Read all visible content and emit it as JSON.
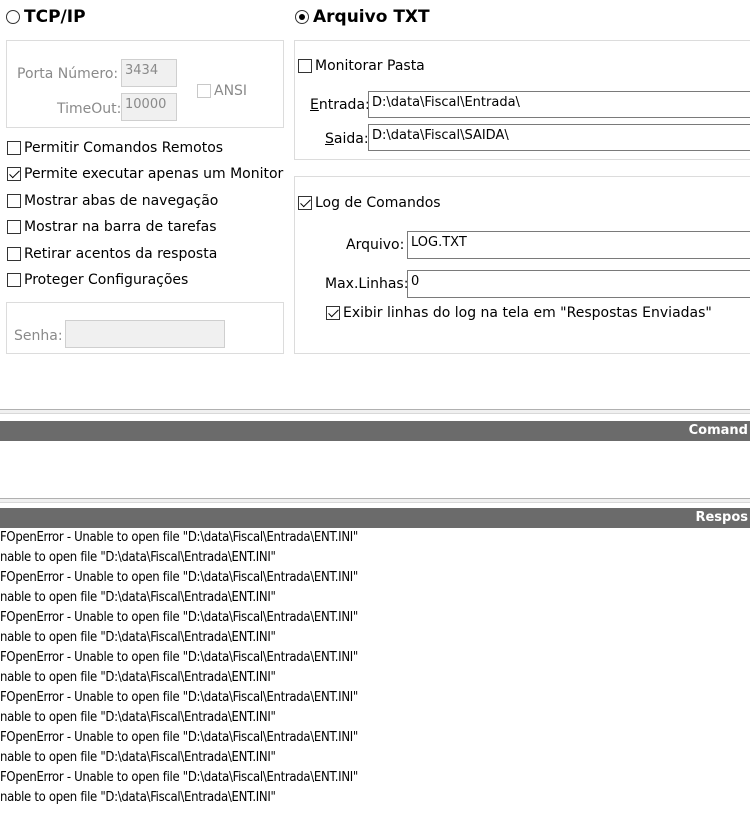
{
  "tcp": {
    "radio_label": "TCP/IP",
    "porta_label": "Porta Número:",
    "porta_value": "3434",
    "timeout_label": "TimeOut:",
    "timeout_value": "10000",
    "ansi_label": "ANSI"
  },
  "options": [
    {
      "label": "Permitir Comandos Remotos",
      "checked": false
    },
    {
      "label": "Permite executar apenas um Monitor",
      "checked": true
    },
    {
      "label": "Mostrar abas de navegação",
      "checked": false
    },
    {
      "label": "Mostrar na barra de tarefas",
      "checked": false
    },
    {
      "label": "Retirar acentos da resposta",
      "checked": false
    },
    {
      "label": "Proteger Configurações",
      "checked": false
    }
  ],
  "senha": {
    "label": "Senha:",
    "value": ""
  },
  "txt": {
    "radio_label": "Arquivo TXT",
    "monitorar_label": "Monitorar Pasta",
    "entrada_label": "Entrada:",
    "entrada_value": "D:\\data\\Fiscal\\Entrada\\",
    "saida_label": "Saida:",
    "saida_value": "D:\\data\\Fiscal\\SAIDA\\"
  },
  "log": {
    "log_label": "Log de Comandos",
    "arquivo_label": "Arquivo:",
    "arquivo_value": "LOG.TXT",
    "maxlinhas_label": "Max.Linhas:",
    "maxlinhas_value": "0",
    "exibir_label": "Exibir linhas do log na tela em \"Respostas Enviadas\""
  },
  "comandos_header": "Comand",
  "respostas_header": "Respos",
  "response_lines": [
    "FOpenError - Unable to open file \"D:\\data\\Fiscal\\Entrada\\ENT.INI\"",
    "nable to open file \"D:\\data\\Fiscal\\Entrada\\ENT.INI\"",
    "FOpenError - Unable to open file \"D:\\data\\Fiscal\\Entrada\\ENT.INI\"",
    "nable to open file \"D:\\data\\Fiscal\\Entrada\\ENT.INI\"",
    "FOpenError - Unable to open file \"D:\\data\\Fiscal\\Entrada\\ENT.INI\"",
    "nable to open file \"D:\\data\\Fiscal\\Entrada\\ENT.INI\"",
    "FOpenError - Unable to open file \"D:\\data\\Fiscal\\Entrada\\ENT.INI\"",
    "nable to open file \"D:\\data\\Fiscal\\Entrada\\ENT.INI\"",
    "FOpenError - Unable to open file \"D:\\data\\Fiscal\\Entrada\\ENT.INI\"",
    "nable to open file \"D:\\data\\Fiscal\\Entrada\\ENT.INI\"",
    "FOpenError - Unable to open file \"D:\\data\\Fiscal\\Entrada\\ENT.INI\"",
    "nable to open file \"D:\\data\\Fiscal\\Entrada\\ENT.INI\"",
    "FOpenError - Unable to open file \"D:\\data\\Fiscal\\Entrada\\ENT.INI\"",
    "nable to open file \"D:\\data\\Fiscal\\Entrada\\ENT.INI\""
  ]
}
